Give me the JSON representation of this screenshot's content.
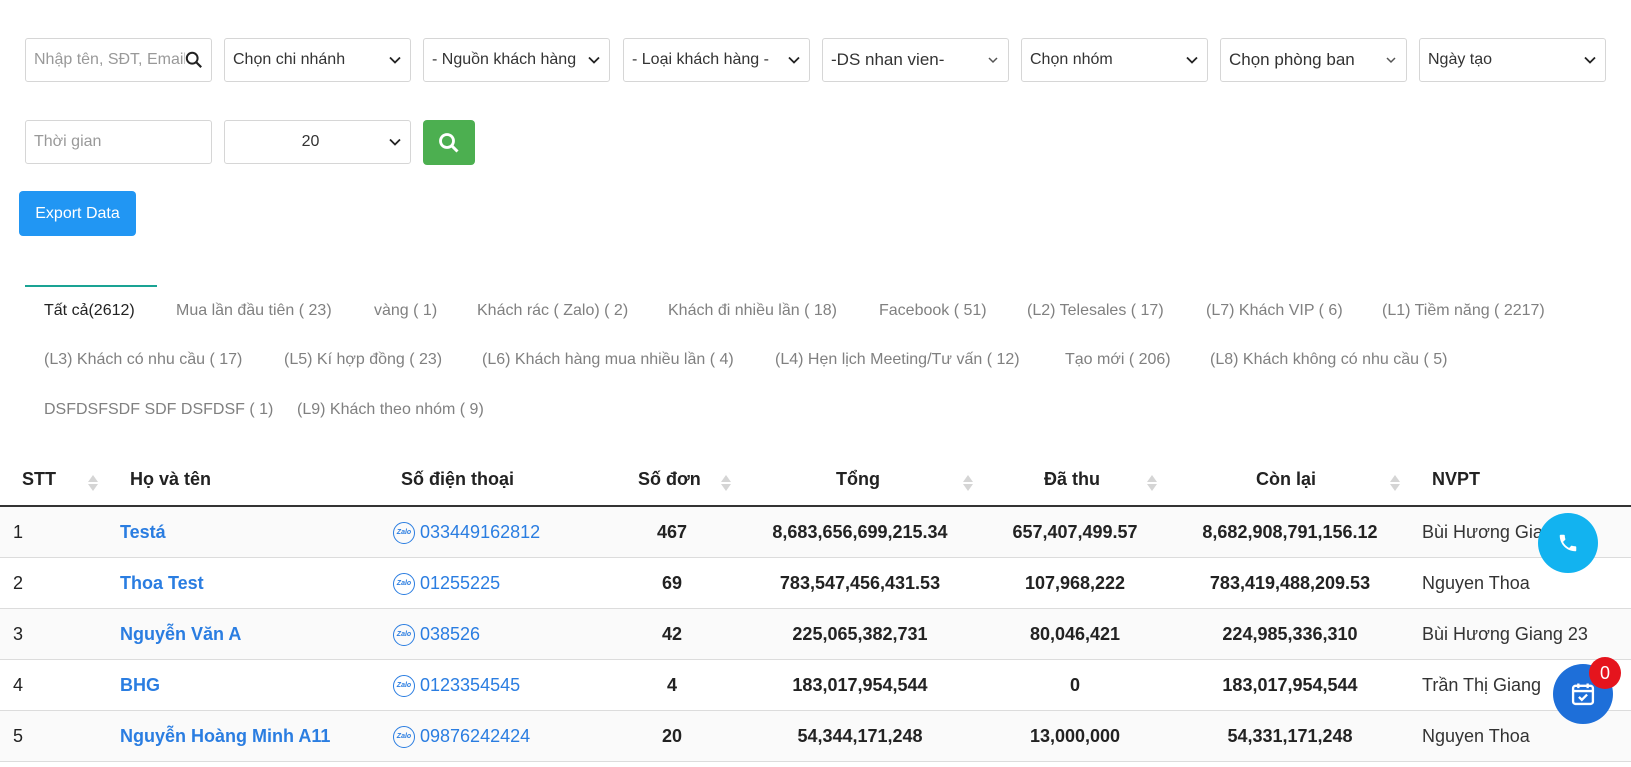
{
  "filters": {
    "search_placeholder": "Nhập tên, SĐT, Email",
    "branch": "Chọn chi nhánh",
    "source": "- Nguồn khách hàng",
    "customer_type": "- Loại khách hàng -",
    "staff": "-DS nhan vien-",
    "group": "Chọn nhóm",
    "department": "Chọn phòng ban",
    "date_type": "Ngày tạo",
    "time_placeholder": "Thời gian",
    "page_size": "20"
  },
  "export_label": "Export Data",
  "tabs": [
    "Tất cả(2612)",
    "Mua lần đầu tiên ( 23)",
    "vàng ( 1)",
    "Khách rác ( Zalo) ( 2)",
    "Khách đi nhiều lần ( 18)",
    "Facebook ( 51)",
    "(L2) Telesales ( 17)",
    "(L7) Khách VIP ( 6)",
    "(L1) Tiềm năng ( 2217)",
    "(L3) Khách có nhu cầu ( 17)",
    "(L5) Kí hợp đồng ( 23)",
    "(L6) Khách hàng mua nhiều lần ( 4)",
    "(L4) Hẹn lịch Meeting/Tư vấn ( 12)",
    "Tạo mới ( 206)",
    "(L8) Khách không có nhu cầu ( 5)",
    "DSFDSFSDF SDF DSFDSF ( 1)",
    "(L9) Khách theo nhóm ( 9)"
  ],
  "columns": {
    "stt": "STT",
    "name": "Họ và tên",
    "phone": "Số điện thoại",
    "orders": "Số đơn",
    "total": "Tổng",
    "paid": "Đã thu",
    "remain": "Còn lại",
    "staff": "NVPT"
  },
  "zalo_label": "Zalo",
  "rows": [
    {
      "stt": "1",
      "name": "Testá",
      "phone": "033449162812",
      "orders": "467",
      "total": "8,683,656,699,215.34",
      "paid": "657,407,499.57",
      "remain": "8,682,908,791,156.12",
      "staff": "Bùi Hương Giang"
    },
    {
      "stt": "2",
      "name": "Thoa Test",
      "phone": "01255225",
      "orders": "69",
      "total": "783,547,456,431.53",
      "paid": "107,968,222",
      "remain": "783,419,488,209.53",
      "staff": "Nguyen Thoa"
    },
    {
      "stt": "3",
      "name": "Nguyễn Văn A",
      "phone": "038526",
      "orders": "42",
      "total": "225,065,382,731",
      "paid": "80,046,421",
      "remain": "224,985,336,310",
      "staff": "Bùi Hương Giang 23"
    },
    {
      "stt": "4",
      "name": "BHG",
      "phone": "0123354545",
      "orders": "4",
      "total": "183,017,954,544",
      "paid": "0",
      "remain": "183,017,954,544",
      "staff": "Trần Thị Giang"
    },
    {
      "stt": "5",
      "name": "Nguyễn Hoàng Minh A11",
      "phone": "09876242424",
      "orders": "20",
      "total": "54,344,171,248",
      "paid": "13,000,000",
      "remain": "54,331,171,248",
      "staff": "Nguyen Thoa"
    }
  ],
  "notification_count": "0",
  "colors": {
    "green": "#4caf50",
    "blue": "#2196f3",
    "link": "#2a7de1",
    "call": "#12b3f0",
    "badge": "#e5141d"
  }
}
